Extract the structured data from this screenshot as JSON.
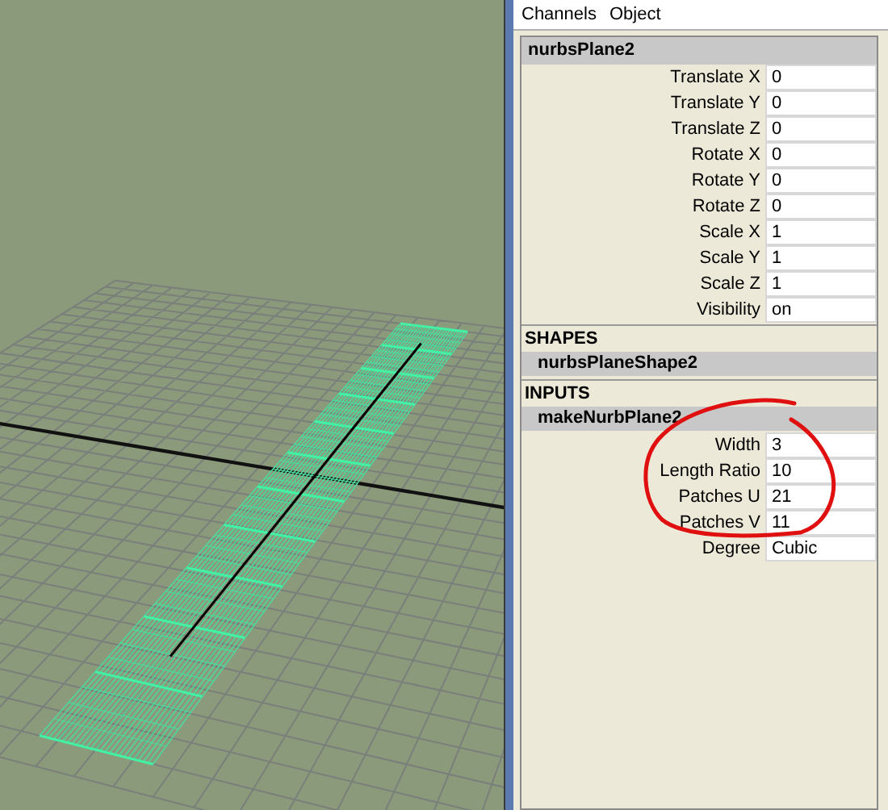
{
  "menu": [
    "Channels",
    "Object"
  ],
  "node": {
    "name": "nurbsPlane2",
    "attributes": [
      {
        "label": "Translate X",
        "value": "0"
      },
      {
        "label": "Translate Y",
        "value": "0"
      },
      {
        "label": "Translate Z",
        "value": "0"
      },
      {
        "label": "Rotate X",
        "value": "0"
      },
      {
        "label": "Rotate Y",
        "value": "0"
      },
      {
        "label": "Rotate Z",
        "value": "0"
      },
      {
        "label": "Scale X",
        "value": "1"
      },
      {
        "label": "Scale Y",
        "value": "1"
      },
      {
        "label": "Scale Z",
        "value": "1"
      },
      {
        "label": "Visibility",
        "value": "on"
      }
    ]
  },
  "shapes": {
    "heading": "SHAPES",
    "nodes": [
      "nurbsPlaneShape2"
    ]
  },
  "inputs": {
    "heading": "INPUTS",
    "nodes": [
      {
        "name": "makeNurbPlane2",
        "attributes": [
          {
            "label": "Width",
            "value": "3"
          },
          {
            "label": "Length Ratio",
            "value": "10"
          },
          {
            "label": "Patches U",
            "value": "21"
          },
          {
            "label": "Patches V",
            "value": "11"
          },
          {
            "label": "Degree",
            "value": "Cubic"
          }
        ]
      }
    ]
  }
}
